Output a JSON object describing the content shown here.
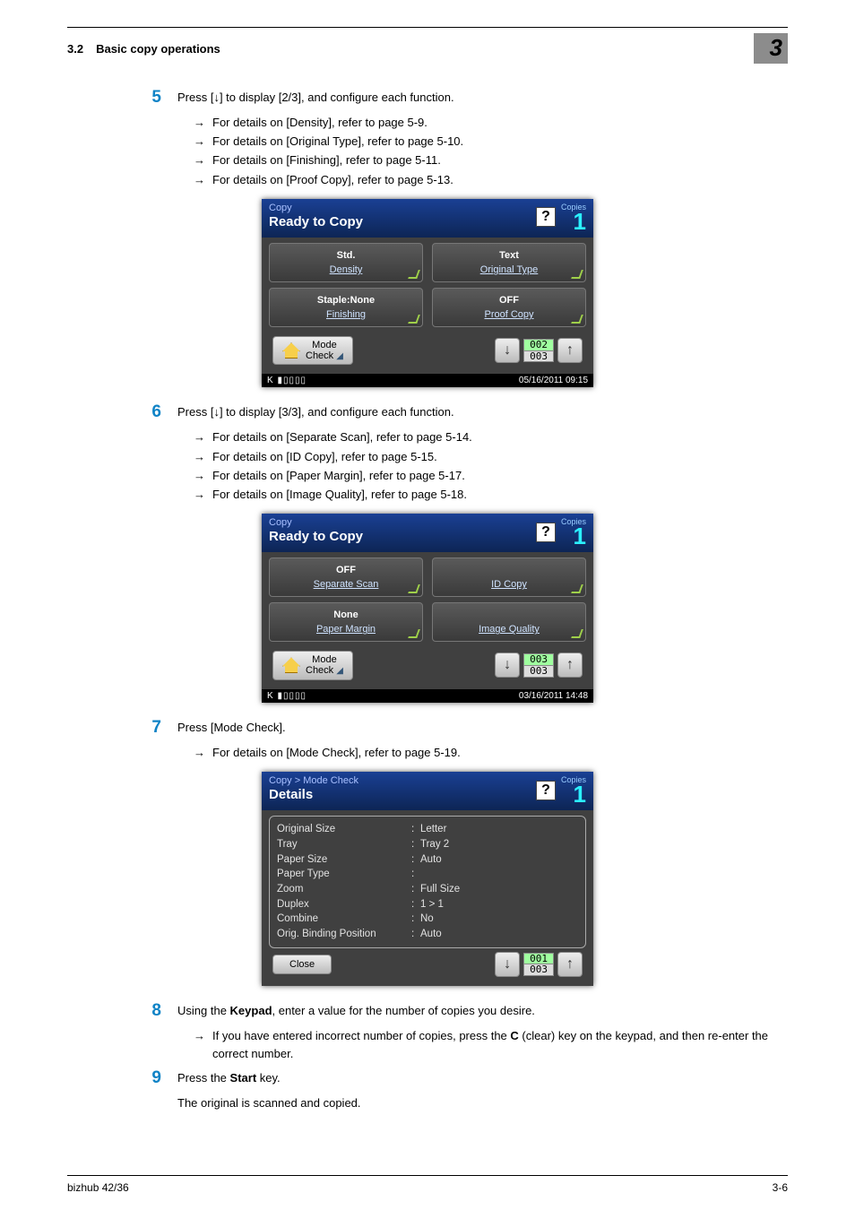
{
  "header": {
    "section_num": "3.2",
    "section_title": "Basic copy operations",
    "chapter_badge": "3"
  },
  "step5": {
    "num": "5",
    "text": "Press [↓] to display [2/3], and configure each function.",
    "subs": [
      "For details on [Density], refer to page 5-9.",
      "For details on [Original Type], refer to page 5-10.",
      "For details on [Finishing], refer to page 5-11.",
      "For details on [Proof Copy], refer to page 5-13."
    ]
  },
  "lcd1": {
    "crumb": "Copy",
    "title": "Ready to Copy",
    "copies_label": "Copies",
    "copies": "1",
    "cells": [
      {
        "val": "Std.",
        "lbl": "Density"
      },
      {
        "val": "Text",
        "lbl": "Original Type"
      },
      {
        "val": "Staple:None",
        "lbl": "Finishing"
      },
      {
        "val": "OFF",
        "lbl": "Proof Copy"
      }
    ],
    "mode_line1": "Mode",
    "mode_line2": "Check",
    "page_cur": "002",
    "page_tot": "003",
    "status_left": "K ▮▯▯▯▯",
    "status_right": "05/16/2011 09:15"
  },
  "step6": {
    "num": "6",
    "text": "Press [↓] to display [3/3], and configure each function.",
    "subs": [
      "For details on [Separate Scan], refer to page 5-14.",
      "For details on [ID Copy], refer to page 5-15.",
      "For details on [Paper Margin], refer to page 5-17.",
      "For details on [Image Quality], refer to page 5-18."
    ]
  },
  "lcd2": {
    "crumb": "Copy",
    "title": "Ready to Copy",
    "copies_label": "Copies",
    "copies": "1",
    "cells": [
      {
        "val": "OFF",
        "lbl": "Separate Scan",
        "blank": false
      },
      {
        "val": "",
        "lbl": "ID Copy",
        "blank": true
      },
      {
        "val": "None",
        "lbl": "Paper Margin",
        "blank": false
      },
      {
        "val": "",
        "lbl": "Image Quality",
        "blank": true
      }
    ],
    "mode_line1": "Mode",
    "mode_line2": "Check",
    "page_cur": "003",
    "page_tot": "003",
    "status_left": "K ▮▯▯▯▯",
    "status_right": "03/16/2011 14:48"
  },
  "step7": {
    "num": "7",
    "text": "Press [Mode Check].",
    "subs": [
      "For details on [Mode Check], refer to page 5-19."
    ]
  },
  "lcd3": {
    "crumb": "Copy > Mode Check",
    "title": "Details",
    "copies_label": "Copies",
    "copies": "1",
    "rows": [
      {
        "k": "Original Size",
        "v": "Letter"
      },
      {
        "k": "Tray",
        "v": "Tray 2"
      },
      {
        "k": "Paper Size",
        "v": "Auto"
      },
      {
        "k": "Paper Type",
        "v": ""
      },
      {
        "k": "Zoom",
        "v": "Full Size"
      },
      {
        "k": "Duplex",
        "v": "1 > 1"
      },
      {
        "k": "Combine",
        "v": "No"
      },
      {
        "k": "Orig. Binding Position",
        "v": "Auto"
      }
    ],
    "close": "Close",
    "page_cur": "001",
    "page_tot": "003",
    "status_left": "",
    "status_right": ""
  },
  "step8": {
    "num": "8",
    "text_pre": "Using the ",
    "text_bold1": "Keypad",
    "text_post": ", enter a value for the number of copies you desire.",
    "sub_pre": "If you have entered incorrect number of copies, press the ",
    "sub_bold": "C",
    "sub_post": " (clear) key on the keypad, and then re-enter the correct number."
  },
  "step9": {
    "num": "9",
    "text_pre": "Press the ",
    "text_bold": "Start",
    "text_post": " key.",
    "text2": "The original is scanned and copied."
  },
  "footer": {
    "left": "bizhub 42/36",
    "right": "3-6"
  }
}
